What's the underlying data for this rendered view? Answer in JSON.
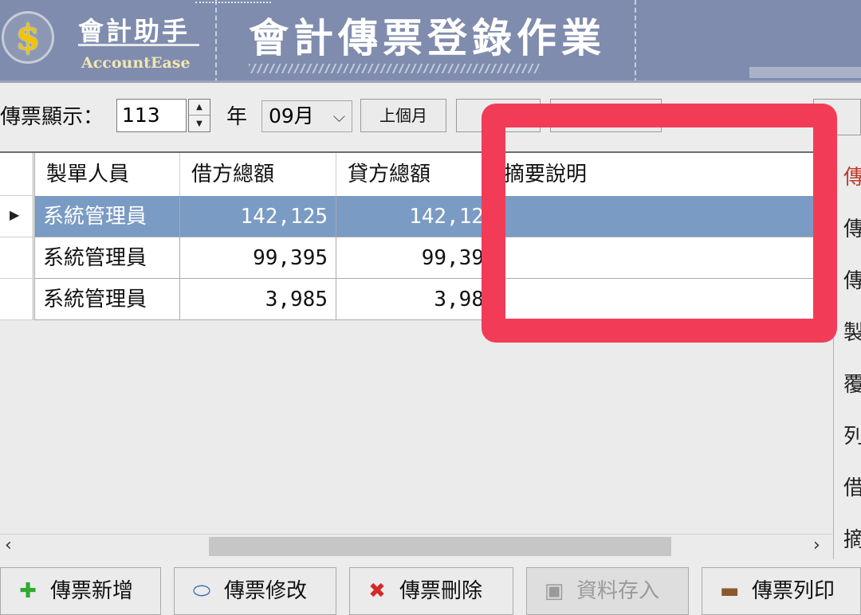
{
  "header": {
    "logo_symbol": "$",
    "brand_zh": "會計助手",
    "brand_en": "AccountEase",
    "title": "會計傳票登錄作業"
  },
  "toolbar": {
    "display_label": "傳票顯示：",
    "year_value": "113",
    "year_unit": "年",
    "month_value": "09月",
    "prev_month_label": "上個月"
  },
  "grid": {
    "columns": [
      "製單人員",
      "借方總額",
      "貸方總額",
      "摘要說明"
    ],
    "rows": [
      {
        "creator": "系統管理員",
        "debit": "142,125",
        "credit": "142,12",
        "summary": ""
      },
      {
        "creator": "系統管理員",
        "debit": "99,395",
        "credit": "99,39",
        "summary": ""
      },
      {
        "creator": "系統管理員",
        "debit": "3,985",
        "credit": "3,98",
        "summary": ""
      }
    ],
    "selected_row_index": 0
  },
  "side_labels": [
    "傳",
    "傳",
    "傳",
    "製",
    "覆",
    "列",
    "借",
    "摘"
  ],
  "buttons": {
    "add": "傳票新增",
    "edit": "傳票修改",
    "delete": "傳票刪除",
    "save": "資料存入",
    "print": "傳票列印"
  },
  "colors": {
    "header_bg": "#7f8cae",
    "selected_row": "#7a9bc4",
    "highlight": "#f23c57",
    "logo_gold": "#f0c400"
  },
  "icons": {
    "add": "plus-icon",
    "edit": "eraser-icon",
    "delete": "x-icon",
    "save": "floppy-icon",
    "print": "printer-icon"
  }
}
